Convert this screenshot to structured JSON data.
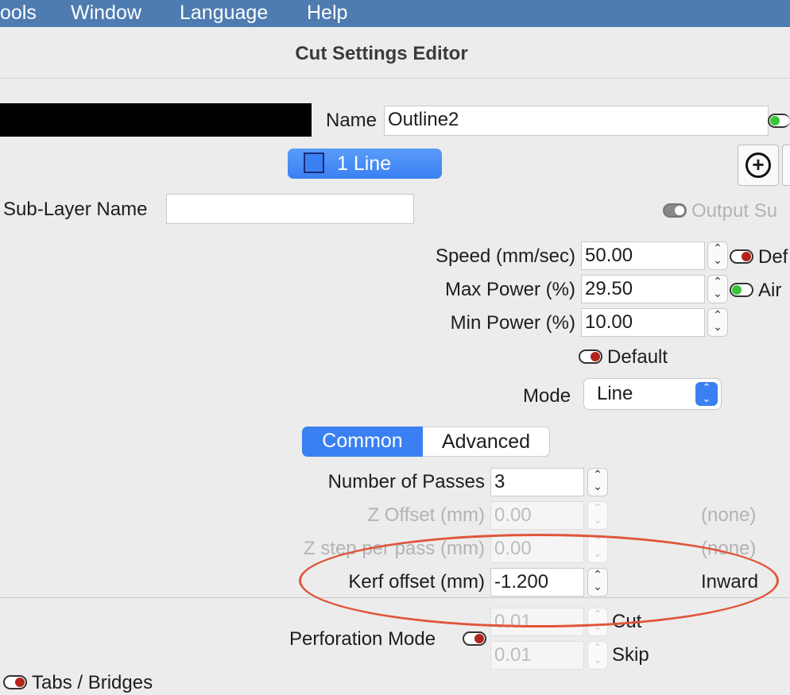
{
  "menubar": {
    "items": [
      "ools",
      "Window",
      "Language",
      "Help"
    ]
  },
  "window": {
    "title": "Cut Settings Editor"
  },
  "name_row": {
    "label": "Name",
    "value": "Outline2"
  },
  "layer_button": {
    "label": "1 Line"
  },
  "sublayer": {
    "label": "Sub-Layer Name",
    "value": "",
    "output_label": "Output Su"
  },
  "speed": {
    "label": "Speed (mm/sec)",
    "value": "50.00",
    "right_label": "Def"
  },
  "max_power": {
    "label": "Max Power (%)",
    "value": "29.50",
    "right_label": "Air"
  },
  "min_power": {
    "label": "Min Power (%)",
    "value": "10.00"
  },
  "default_toggle": {
    "label": "Default"
  },
  "mode": {
    "label": "Mode",
    "value": "Line"
  },
  "tabs": {
    "common": "Common",
    "advanced": "Advanced"
  },
  "passes": {
    "label": "Number of Passes",
    "value": "3"
  },
  "z_offset": {
    "label": "Z Offset (mm)",
    "value": "0.00",
    "right": "(none)"
  },
  "z_step": {
    "label": "Z step per pass (mm)",
    "value": "0.00",
    "right": "(none)"
  },
  "kerf": {
    "label": "Kerf offset (mm)",
    "value": "-1.200",
    "right": "Inward"
  },
  "perforation": {
    "label": "Perforation Mode",
    "cut_value": "0.01",
    "cut_label": "Cut",
    "skip_value": "0.01",
    "skip_label": "Skip"
  },
  "tabs_bridges": {
    "label": "Tabs / Bridges"
  },
  "colors": {
    "menubar": "#4e7bb0",
    "accent": "#3a80f2",
    "annotation": "#e0553a"
  }
}
